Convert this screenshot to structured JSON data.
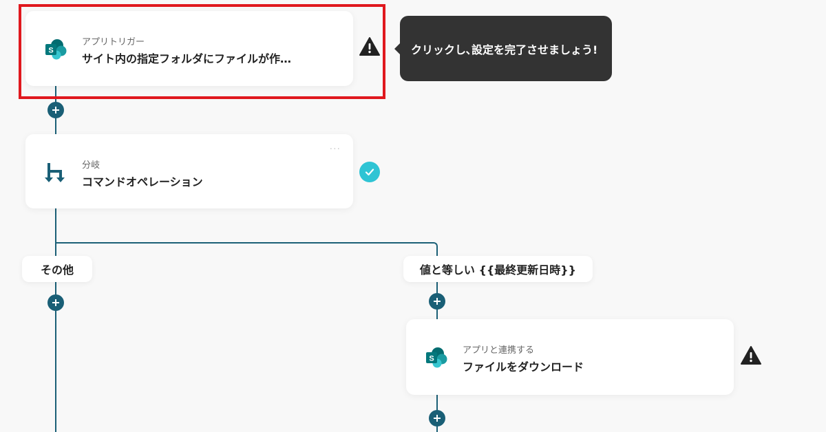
{
  "trigger_card": {
    "subtitle": "アプリトリガー",
    "title": "サイト内の指定フォルダにファイルが作…",
    "icon": "sharepoint-icon"
  },
  "tooltip": {
    "text": "クリックし､設定を完了させましょう!"
  },
  "branch_card": {
    "subtitle": "分岐",
    "title": "コマンドオペレーション",
    "icon": "branch-icon",
    "more": "···"
  },
  "branches": {
    "left_label": "その他",
    "right_label": "値と等しい {{最終更新日時}}"
  },
  "download_card": {
    "subtitle": "アプリと連携する",
    "title": "ファイルをダウンロード",
    "icon": "sharepoint-icon"
  },
  "colors": {
    "line": "#1a5f76",
    "highlight": "#e0181e",
    "ok": "#2fc4d4",
    "tooltip_bg": "#333333"
  }
}
